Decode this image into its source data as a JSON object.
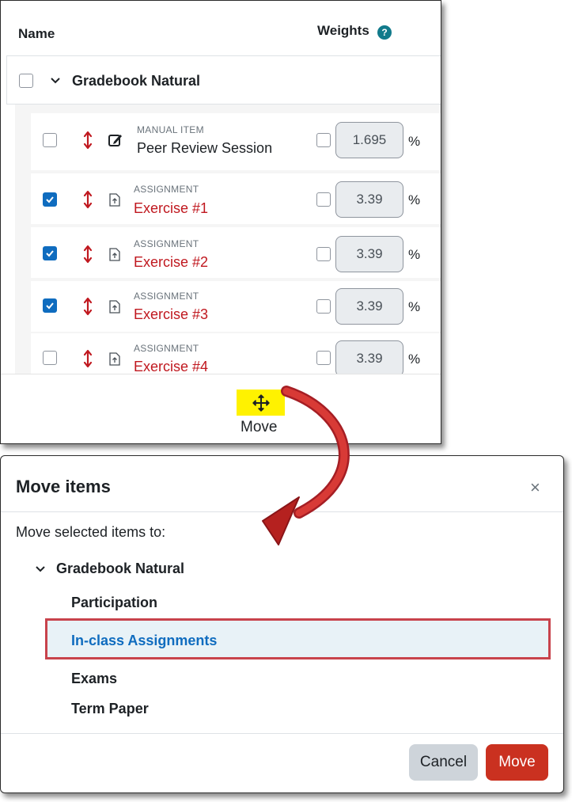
{
  "table": {
    "name_header": "Name",
    "weights_header": "Weights",
    "help_glyph": "?",
    "category": {
      "title": "Gradebook Natural"
    },
    "items": [
      {
        "type": "MANUAL ITEM",
        "name": "Peer Review Session",
        "checked": false,
        "weight": "1.695",
        "pct": "%",
        "icon": "edit-icon"
      },
      {
        "type": "ASSIGNMENT",
        "name": "Exercise #1",
        "checked": true,
        "weight": "3.39",
        "pct": "%",
        "icon": "assignment-icon"
      },
      {
        "type": "ASSIGNMENT",
        "name": "Exercise #2",
        "checked": true,
        "weight": "3.39",
        "pct": "%",
        "icon": "assignment-icon"
      },
      {
        "type": "ASSIGNMENT",
        "name": "Exercise #3",
        "checked": true,
        "weight": "3.39",
        "pct": "%",
        "icon": "assignment-icon"
      },
      {
        "type": "ASSIGNMENT",
        "name": "Exercise #4",
        "checked": false,
        "weight": "3.39",
        "pct": "%",
        "icon": "assignment-icon"
      }
    ],
    "footer": {
      "move_label": "Move",
      "move_icon": "move-arrows-icon"
    }
  },
  "modal": {
    "title": "Move items",
    "close_glyph": "×",
    "subtitle": "Move selected items to:",
    "tree_root": "Gradebook Natural",
    "tree_items": [
      "Participation",
      "In-class Assignments",
      "Exams",
      "Term Paper"
    ],
    "selected_item": "In-class Assignments",
    "cancel_label": "Cancel",
    "move_label": "Move"
  },
  "colors": {
    "accent_blue": "#0f6cbf",
    "link_red": "#c0181f",
    "move_button": "#ca3120",
    "highlight_yellow": "#fff200",
    "selection_border": "#c8434c"
  }
}
